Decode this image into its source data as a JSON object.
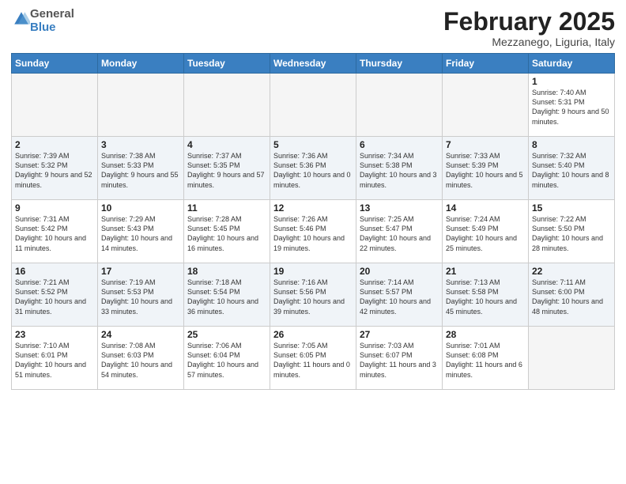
{
  "logo": {
    "text1": "General",
    "text2": "Blue"
  },
  "title": "February 2025",
  "subtitle": "Mezzanego, Liguria, Italy",
  "weekdays": [
    "Sunday",
    "Monday",
    "Tuesday",
    "Wednesday",
    "Thursday",
    "Friday",
    "Saturday"
  ],
  "weeks": [
    [
      {
        "day": "",
        "info": ""
      },
      {
        "day": "",
        "info": ""
      },
      {
        "day": "",
        "info": ""
      },
      {
        "day": "",
        "info": ""
      },
      {
        "day": "",
        "info": ""
      },
      {
        "day": "",
        "info": ""
      },
      {
        "day": "1",
        "info": "Sunrise: 7:40 AM\nSunset: 5:31 PM\nDaylight: 9 hours and 50 minutes."
      }
    ],
    [
      {
        "day": "2",
        "info": "Sunrise: 7:39 AM\nSunset: 5:32 PM\nDaylight: 9 hours and 52 minutes."
      },
      {
        "day": "3",
        "info": "Sunrise: 7:38 AM\nSunset: 5:33 PM\nDaylight: 9 hours and 55 minutes."
      },
      {
        "day": "4",
        "info": "Sunrise: 7:37 AM\nSunset: 5:35 PM\nDaylight: 9 hours and 57 minutes."
      },
      {
        "day": "5",
        "info": "Sunrise: 7:36 AM\nSunset: 5:36 PM\nDaylight: 10 hours and 0 minutes."
      },
      {
        "day": "6",
        "info": "Sunrise: 7:34 AM\nSunset: 5:38 PM\nDaylight: 10 hours and 3 minutes."
      },
      {
        "day": "7",
        "info": "Sunrise: 7:33 AM\nSunset: 5:39 PM\nDaylight: 10 hours and 5 minutes."
      },
      {
        "day": "8",
        "info": "Sunrise: 7:32 AM\nSunset: 5:40 PM\nDaylight: 10 hours and 8 minutes."
      }
    ],
    [
      {
        "day": "9",
        "info": "Sunrise: 7:31 AM\nSunset: 5:42 PM\nDaylight: 10 hours and 11 minutes."
      },
      {
        "day": "10",
        "info": "Sunrise: 7:29 AM\nSunset: 5:43 PM\nDaylight: 10 hours and 14 minutes."
      },
      {
        "day": "11",
        "info": "Sunrise: 7:28 AM\nSunset: 5:45 PM\nDaylight: 10 hours and 16 minutes."
      },
      {
        "day": "12",
        "info": "Sunrise: 7:26 AM\nSunset: 5:46 PM\nDaylight: 10 hours and 19 minutes."
      },
      {
        "day": "13",
        "info": "Sunrise: 7:25 AM\nSunset: 5:47 PM\nDaylight: 10 hours and 22 minutes."
      },
      {
        "day": "14",
        "info": "Sunrise: 7:24 AM\nSunset: 5:49 PM\nDaylight: 10 hours and 25 minutes."
      },
      {
        "day": "15",
        "info": "Sunrise: 7:22 AM\nSunset: 5:50 PM\nDaylight: 10 hours and 28 minutes."
      }
    ],
    [
      {
        "day": "16",
        "info": "Sunrise: 7:21 AM\nSunset: 5:52 PM\nDaylight: 10 hours and 31 minutes."
      },
      {
        "day": "17",
        "info": "Sunrise: 7:19 AM\nSunset: 5:53 PM\nDaylight: 10 hours and 33 minutes."
      },
      {
        "day": "18",
        "info": "Sunrise: 7:18 AM\nSunset: 5:54 PM\nDaylight: 10 hours and 36 minutes."
      },
      {
        "day": "19",
        "info": "Sunrise: 7:16 AM\nSunset: 5:56 PM\nDaylight: 10 hours and 39 minutes."
      },
      {
        "day": "20",
        "info": "Sunrise: 7:14 AM\nSunset: 5:57 PM\nDaylight: 10 hours and 42 minutes."
      },
      {
        "day": "21",
        "info": "Sunrise: 7:13 AM\nSunset: 5:58 PM\nDaylight: 10 hours and 45 minutes."
      },
      {
        "day": "22",
        "info": "Sunrise: 7:11 AM\nSunset: 6:00 PM\nDaylight: 10 hours and 48 minutes."
      }
    ],
    [
      {
        "day": "23",
        "info": "Sunrise: 7:10 AM\nSunset: 6:01 PM\nDaylight: 10 hours and 51 minutes."
      },
      {
        "day": "24",
        "info": "Sunrise: 7:08 AM\nSunset: 6:03 PM\nDaylight: 10 hours and 54 minutes."
      },
      {
        "day": "25",
        "info": "Sunrise: 7:06 AM\nSunset: 6:04 PM\nDaylight: 10 hours and 57 minutes."
      },
      {
        "day": "26",
        "info": "Sunrise: 7:05 AM\nSunset: 6:05 PM\nDaylight: 11 hours and 0 minutes."
      },
      {
        "day": "27",
        "info": "Sunrise: 7:03 AM\nSunset: 6:07 PM\nDaylight: 11 hours and 3 minutes."
      },
      {
        "day": "28",
        "info": "Sunrise: 7:01 AM\nSunset: 6:08 PM\nDaylight: 11 hours and 6 minutes."
      },
      {
        "day": "",
        "info": ""
      }
    ]
  ]
}
